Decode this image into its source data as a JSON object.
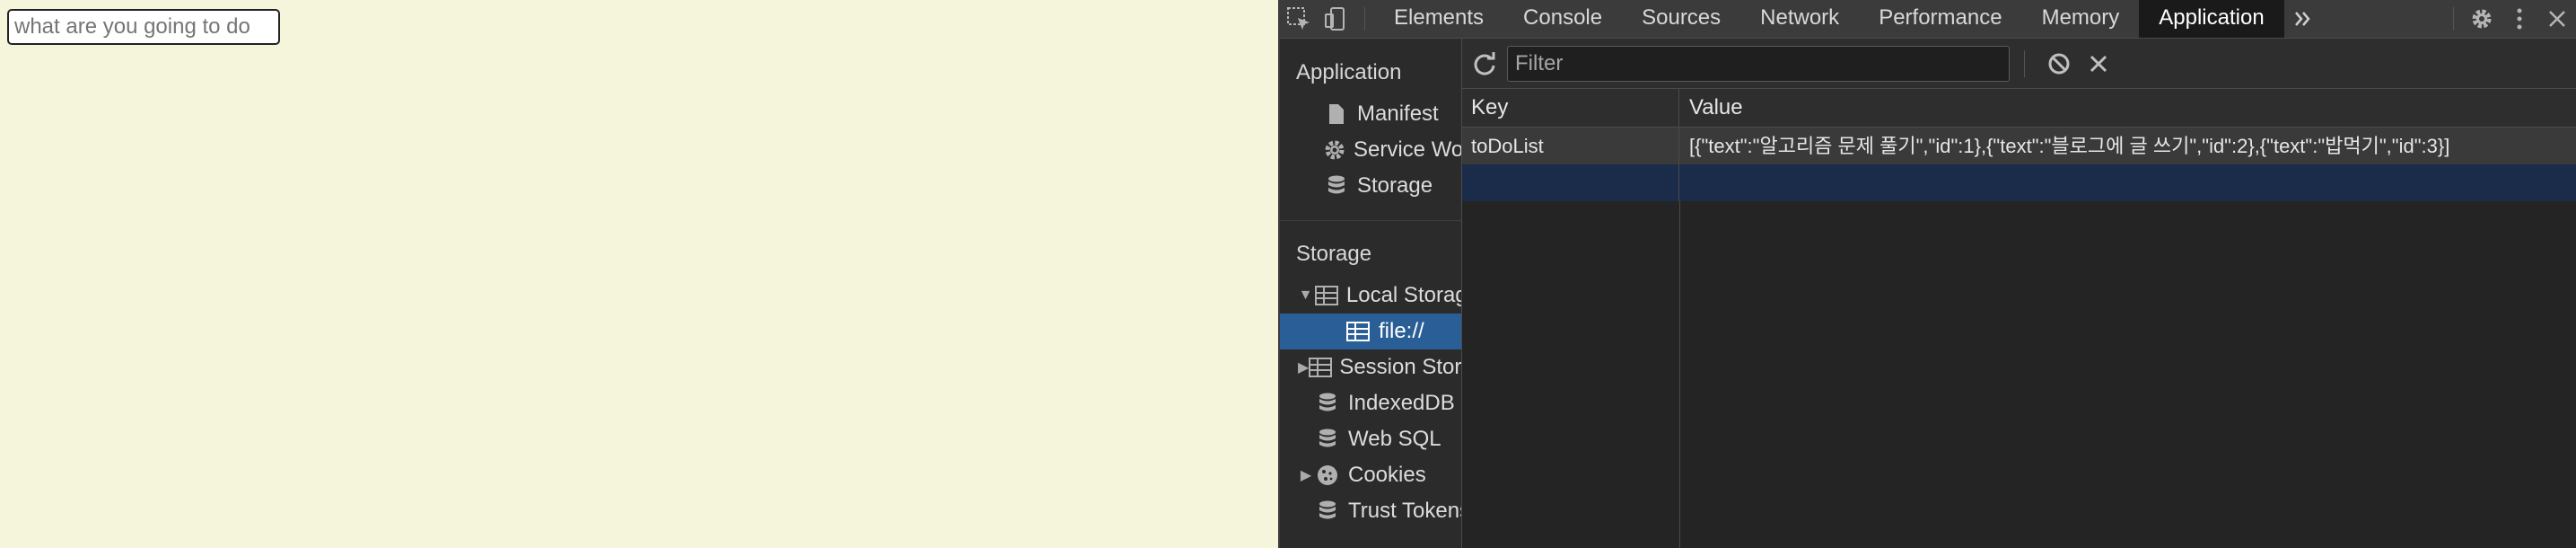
{
  "page": {
    "input_placeholder": "what are you going to do"
  },
  "devtools": {
    "tabs": [
      {
        "label": "Elements"
      },
      {
        "label": "Console"
      },
      {
        "label": "Sources"
      },
      {
        "label": "Network"
      },
      {
        "label": "Performance"
      },
      {
        "label": "Memory"
      },
      {
        "label": "Application"
      }
    ],
    "active_tab": "Application",
    "sidebar": {
      "application_title": "Application",
      "application_items": [
        {
          "label": "Manifest",
          "icon": "document-icon"
        },
        {
          "label": "Service Workers",
          "icon": "gear-icon"
        },
        {
          "label": "Storage",
          "icon": "database-icon"
        }
      ],
      "storage_title": "Storage",
      "storage_items": [
        {
          "label": "Local Storage",
          "icon": "grid-icon",
          "expanded": true
        },
        {
          "label": "file://",
          "icon": "grid-icon",
          "selected": true
        },
        {
          "label": "Session Storage",
          "icon": "grid-icon",
          "expanded": false
        },
        {
          "label": "IndexedDB",
          "icon": "database-icon"
        },
        {
          "label": "Web SQL",
          "icon": "database-icon"
        },
        {
          "label": "Cookies",
          "icon": "cookie-icon",
          "expanded": false
        },
        {
          "label": "Trust Tokens",
          "icon": "database-icon"
        }
      ]
    },
    "filter": {
      "placeholder": "Filter"
    },
    "table": {
      "headers": {
        "key": "Key",
        "value": "Value"
      },
      "rows": [
        {
          "key": "toDoList",
          "value": "[{\"text\":\"알고리즘 문제 풀기\",\"id\":1},{\"text\":\"블로그에 글 쓰기\",\"id\":2},{\"text\":\"밥먹기\",\"id\":3}]"
        }
      ]
    },
    "colors": {
      "page_bg": "#f5f5dc",
      "selected_bg": "#2a5e96",
      "active_tab_bg": "#1a1a1a"
    }
  }
}
